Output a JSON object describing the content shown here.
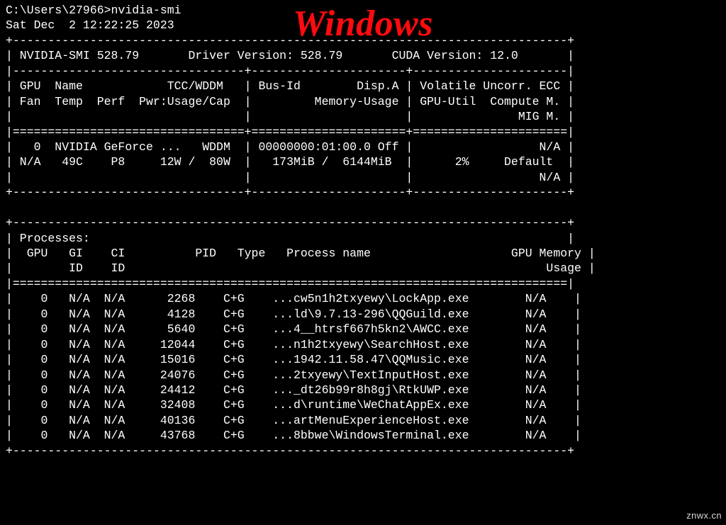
{
  "overlay": {
    "title": "Windows"
  },
  "watermark": "znwx.cn",
  "prompt": {
    "path": "C:\\Users\\27966>",
    "command": "nvidia-smi"
  },
  "timestamp": "Sat Dec  2 12:22:25 2023",
  "header": {
    "smi_version_label": "NVIDIA-SMI",
    "smi_version": "528.79",
    "driver_label": "Driver Version:",
    "driver_version": "528.79",
    "cuda_label": "CUDA Version:",
    "cuda_version": "12.0"
  },
  "col_headers": {
    "row1_left": " GPU  Name            TCC/WDDM ",
    "row1_mid": " Bus-Id        Disp.A ",
    "row1_right": " Volatile Uncorr. ECC ",
    "row2_left": " Fan  Temp  Perf  Pwr:Usage/Cap",
    "row2_mid": "         Memory-Usage ",
    "row2_right": " GPU-Util  Compute M. ",
    "row3_left": "                               ",
    "row3_mid": "                      ",
    "row3_right": "               MIG M. "
  },
  "gpu": {
    "index": "0",
    "name": "NVIDIA GeForce ...",
    "mode": "WDDM",
    "bus_id": "00000000:01:00.0",
    "disp_a": "Off",
    "ecc": "N/A",
    "fan": "N/A",
    "temp": "49C",
    "perf": "P8",
    "pwr_usage": "12W",
    "pwr_cap": "80W",
    "mem_used": "173MiB",
    "mem_total": "6144MiB",
    "gpu_util": "2%",
    "compute_m": "Default",
    "mig_m": "N/A"
  },
  "processes": {
    "title": "Processes:",
    "headers": {
      "gpu": "GPU",
      "gi": "GI",
      "ci": "CI",
      "pid": "PID",
      "type": "Type",
      "name": "Process name",
      "mem": "GPU Memory",
      "gi2": "ID",
      "ci2": "ID",
      "mem2": "Usage"
    },
    "rows": [
      {
        "gpu": "0",
        "gi": "N/A",
        "ci": "N/A",
        "pid": "2268",
        "type": "C+G",
        "name": "...cw5n1h2txyewy\\LockApp.exe",
        "mem": "N/A"
      },
      {
        "gpu": "0",
        "gi": "N/A",
        "ci": "N/A",
        "pid": "4128",
        "type": "C+G",
        "name": "...ld\\9.7.13-296\\QQGuild.exe",
        "mem": "N/A"
      },
      {
        "gpu": "0",
        "gi": "N/A",
        "ci": "N/A",
        "pid": "5640",
        "type": "C+G",
        "name": "...4__htrsf667h5kn2\\AWCC.exe",
        "mem": "N/A"
      },
      {
        "gpu": "0",
        "gi": "N/A",
        "ci": "N/A",
        "pid": "12044",
        "type": "C+G",
        "name": "...n1h2txyewy\\SearchHost.exe",
        "mem": "N/A"
      },
      {
        "gpu": "0",
        "gi": "N/A",
        "ci": "N/A",
        "pid": "15016",
        "type": "C+G",
        "name": "...1942.11.58.47\\QQMusic.exe",
        "mem": "N/A"
      },
      {
        "gpu": "0",
        "gi": "N/A",
        "ci": "N/A",
        "pid": "24076",
        "type": "C+G",
        "name": "...2txyewy\\TextInputHost.exe",
        "mem": "N/A"
      },
      {
        "gpu": "0",
        "gi": "N/A",
        "ci": "N/A",
        "pid": "24412",
        "type": "C+G",
        "name": "..._dt26b99r8h8gj\\RtkUWP.exe",
        "mem": "N/A"
      },
      {
        "gpu": "0",
        "gi": "N/A",
        "ci": "N/A",
        "pid": "32408",
        "type": "C+G",
        "name": "...d\\runtime\\WeChatAppEx.exe",
        "mem": "N/A"
      },
      {
        "gpu": "0",
        "gi": "N/A",
        "ci": "N/A",
        "pid": "40136",
        "type": "C+G",
        "name": "...artMenuExperienceHost.exe",
        "mem": "N/A"
      },
      {
        "gpu": "0",
        "gi": "N/A",
        "ci": "N/A",
        "pid": "43768",
        "type": "C+G",
        "name": "...8bbwe\\WindowsTerminal.exe",
        "mem": "N/A"
      }
    ]
  }
}
